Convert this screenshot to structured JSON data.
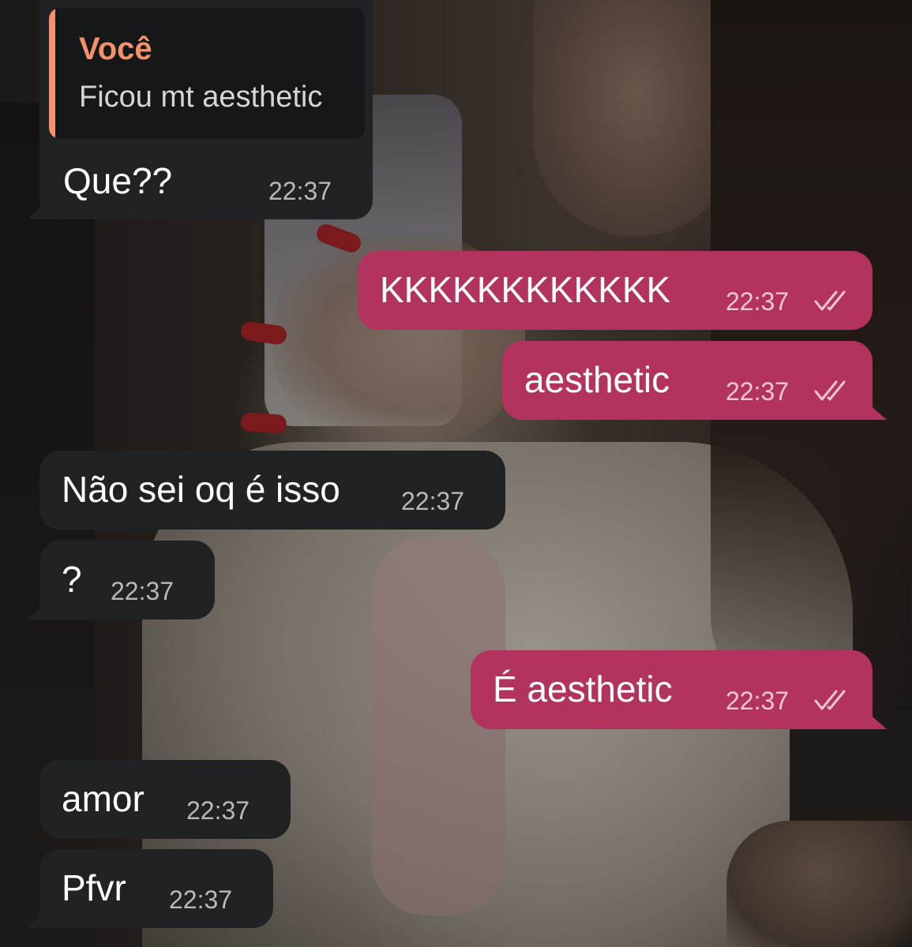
{
  "colors": {
    "incoming_bubble": "#202224",
    "outgoing_bubble": "#b3335f",
    "reply_accent": "#f2916c",
    "time_incoming": "#b7b9bc",
    "time_outgoing": "#f0c7d5"
  },
  "icons": {
    "read_receipt": "double-check-icon"
  },
  "reply": {
    "sender": "Você",
    "text": "Ficou mt aesthetic"
  },
  "messages": [
    {
      "direction": "incoming",
      "text": "Que??",
      "time": "22:37"
    },
    {
      "direction": "outgoing",
      "text": "KKKKKKKKKKKK",
      "time": "22:37",
      "read": true
    },
    {
      "direction": "outgoing",
      "text": "aesthetic",
      "time": "22:37",
      "read": true
    },
    {
      "direction": "incoming",
      "text": "Não sei oq é isso",
      "time": "22:37"
    },
    {
      "direction": "incoming",
      "text": "?",
      "time": "22:37"
    },
    {
      "direction": "outgoing",
      "text": "É aesthetic",
      "time": "22:37",
      "read": true
    },
    {
      "direction": "incoming",
      "text": "amor",
      "time": "22:37"
    },
    {
      "direction": "incoming",
      "text": "Pfvr",
      "time": "22:37"
    }
  ]
}
